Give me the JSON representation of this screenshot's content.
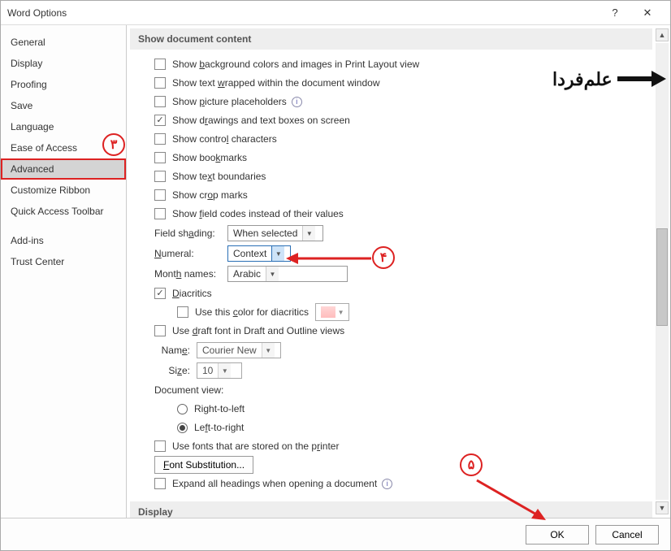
{
  "window": {
    "title": "Word Options"
  },
  "sidebar": {
    "items": [
      "General",
      "Display",
      "Proofing",
      "Save",
      "Language",
      "Ease of Access",
      "Advanced",
      "Customize Ribbon",
      "Quick Access Toolbar",
      "Add-ins",
      "Trust Center"
    ],
    "selected_index": 6
  },
  "section1": {
    "header": "Show document content",
    "bg_colors": "Show background colors and images in Print Layout view",
    "wrap": "Show text wrapped within the document window",
    "placeholders": "Show picture placeholders",
    "drawings": "Show drawings and text boxes on screen",
    "ctrl_chars": "Show control characters",
    "bookmarks": "Show bookmarks",
    "text_bounds": "Show text boundaries",
    "crop": "Show crop marks",
    "field_codes": "Show field codes instead of their values",
    "field_shading_label": "Field shading:",
    "field_shading_value": "When selected",
    "numeral_label": "Numeral:",
    "numeral_value": "Context",
    "month_label": "Month names:",
    "month_value": "Arabic",
    "diacritics": "Diacritics",
    "diacritics_color": "Use this color for diacritics",
    "draft_font": "Use draft font in Draft and Outline views",
    "name_label": "Name:",
    "name_value": "Courier New",
    "size_label": "Size:",
    "size_value": "10",
    "doc_view": "Document view:",
    "rtl": "Right-to-left",
    "ltr": "Left-to-right",
    "printer_fonts": "Use fonts that are stored on the printer",
    "font_sub": "Font Substitution...",
    "expand_headings": "Expand all headings when opening a document"
  },
  "section2": {
    "header": "Display"
  },
  "footer": {
    "ok": "OK",
    "cancel": "Cancel"
  },
  "annotations": {
    "n3": "۳",
    "n4": "۴",
    "n5": "۵",
    "watermark": "علم‌فردا"
  }
}
